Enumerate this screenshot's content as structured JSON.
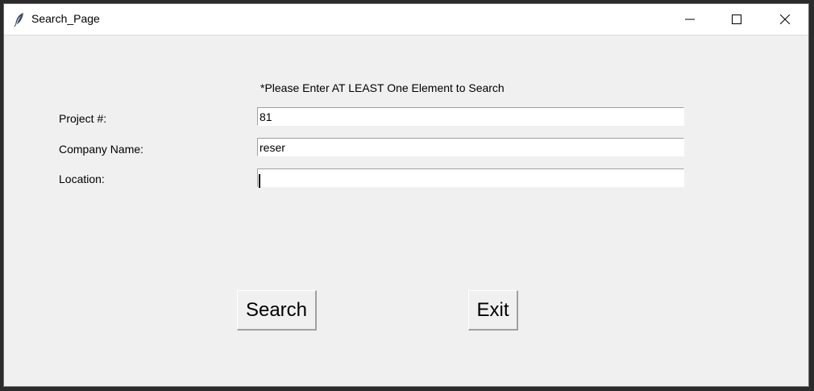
{
  "window": {
    "title": "Search_Page",
    "controls": {
      "minimize": "minimize-icon",
      "maximize": "maximize-icon",
      "close": "close-icon"
    }
  },
  "form": {
    "instruction": "*Please Enter AT LEAST One Element to Search",
    "fields": [
      {
        "label": "Project #:",
        "value": "81"
      },
      {
        "label": "Company Name:",
        "value": "reser"
      },
      {
        "label": "Location:",
        "value": ""
      }
    ]
  },
  "buttons": {
    "search_label": "Search",
    "exit_label": "Exit"
  }
}
